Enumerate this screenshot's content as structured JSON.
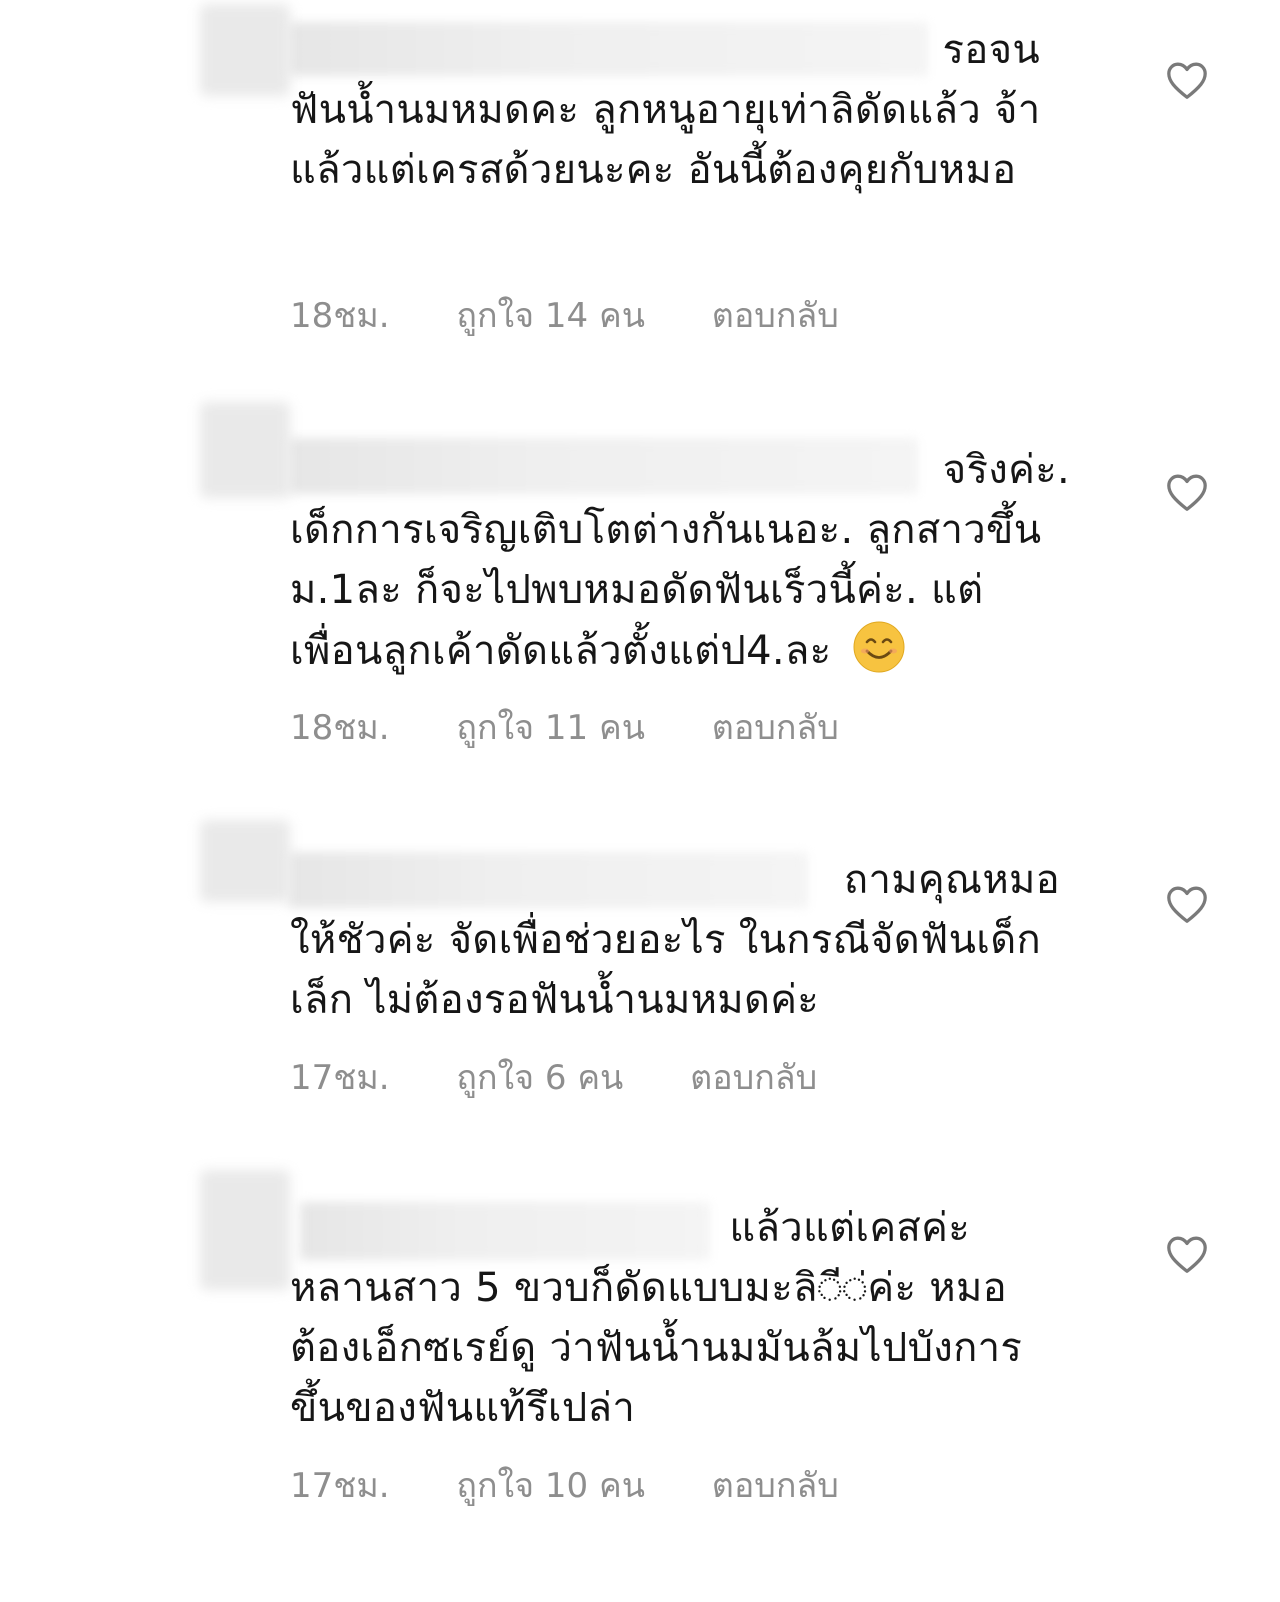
{
  "comments": [
    {
      "text_lead": "รอจน",
      "text_rest": "ฟันน้ำนมหมดคะ ลูกหนูอายุเท่าลิดัดแล้ว จ้าแล้วแต่เครสด้วยนะคะ อันนี้ต้องคุยกับหมอ",
      "time": "18ชม.",
      "likes": "ถูกใจ 14 คน",
      "reply": "ตอบกลับ"
    },
    {
      "text_lead": "จริงค่ะ.",
      "text_rest": "เด็กการเจริญเติบโตต่างกันเนอะ. ลูกสาวขึ้นม.1ละ ก็จะไปพบหมอดัดฟันเร็วนี้ค่ะ. แต่เพื่อนลูกเค้าดัดแล้วตั้งแต่ป4.ละ",
      "emoji": "smiling-face-emoji",
      "time": "18ชม.",
      "likes": "ถูกใจ 11 คน",
      "reply": "ตอบกลับ"
    },
    {
      "text_lead": "ถามคุณหมอ",
      "text_rest": "ให้ชัวค่ะ จัดเพื่อช่วยอะไร ในกรณีจัดฟันเด็กเล็ก ไม่ต้องรอฟันน้ำนมหมดค่ะ",
      "time": "17ชม.",
      "likes": "ถูกใจ 6 คน",
      "reply": "ตอบกลับ"
    },
    {
      "text_lead": "แล้วแต่เคสค่ะ",
      "text_rest": "หลานสาว 5 ขวบก็ดัดแบบมะลิ◌ี◌่ค่ะ หมอต้องเอ็กซเรย์ดู ว่าฟันน้ำนมมันล้มไปบังการขึ้นของฟันแท้รึเปล่า",
      "time": "17ชม.",
      "likes": "ถูกใจ 10 คน",
      "reply": "ตอบกลับ"
    }
  ],
  "icons": {
    "like": "heart-outline-icon"
  },
  "colors": {
    "text": "#161616",
    "meta": "#8e8e8e",
    "heart": "#7a7a7a",
    "emoji": "#f7c340"
  }
}
